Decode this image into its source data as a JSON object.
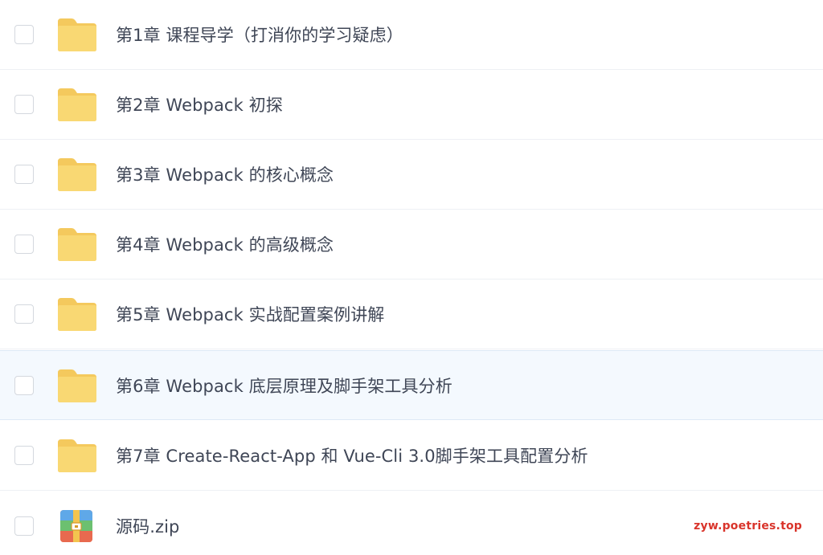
{
  "files": [
    {
      "name": "第1章 课程导学（打消你的学习疑虑）",
      "type": "folder",
      "icon": "folder-icon",
      "selected": false
    },
    {
      "name": "第2章 Webpack 初探",
      "type": "folder",
      "icon": "folder-icon",
      "selected": false
    },
    {
      "name": "第3章 Webpack 的核心概念",
      "type": "folder",
      "icon": "folder-icon",
      "selected": false
    },
    {
      "name": "第4章 Webpack 的高级概念",
      "type": "folder",
      "icon": "folder-icon",
      "selected": false
    },
    {
      "name": "第5章 Webpack 实战配置案例讲解",
      "type": "folder",
      "icon": "folder-icon",
      "selected": false
    },
    {
      "name": "第6章 Webpack 底层原理及脚手架工具分析",
      "type": "folder",
      "icon": "folder-icon",
      "selected": false,
      "hovered": true
    },
    {
      "name": "第7章 Create-React-App 和 Vue-Cli 3.0脚手架工具配置分析",
      "type": "folder",
      "icon": "folder-icon",
      "selected": false
    },
    {
      "name": "源码.zip",
      "type": "zip",
      "icon": "zip-archive-icon",
      "selected": false
    }
  ],
  "watermark": "zyw.poetries.top",
  "colors": {
    "folder": "#f9d873",
    "folder_tab": "#f4c95d",
    "text": "#3f4656",
    "highlight_row": "#f4f9fe",
    "watermark": "#d9342b"
  }
}
